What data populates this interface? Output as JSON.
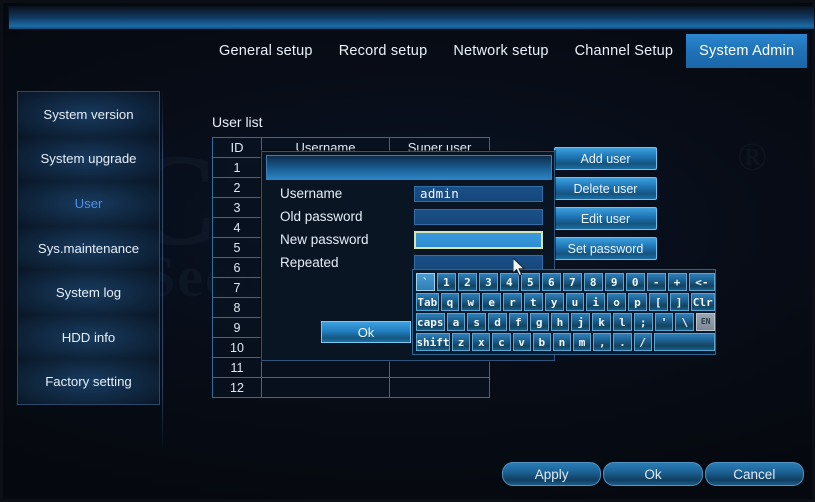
{
  "window": {
    "title": ""
  },
  "nav": {
    "tabs": [
      {
        "label": "General setup",
        "active": false
      },
      {
        "label": "Record setup",
        "active": false
      },
      {
        "label": "Network setup",
        "active": false
      },
      {
        "label": "Channel Setup",
        "active": false
      },
      {
        "label": "System Admin",
        "active": true
      }
    ]
  },
  "sidebar": {
    "items": [
      {
        "label": "System version",
        "active": false
      },
      {
        "label": "System upgrade",
        "active": false
      },
      {
        "label": "User",
        "active": true
      },
      {
        "label": "Sys.maintenance",
        "active": false
      },
      {
        "label": "System log",
        "active": false
      },
      {
        "label": "HDD info",
        "active": false
      },
      {
        "label": "Factory setting",
        "active": false
      }
    ]
  },
  "main": {
    "user_list_label": "User list",
    "table": {
      "headers": [
        "ID",
        "Username",
        "Super user"
      ],
      "rows": [
        {
          "id": "1",
          "username": "",
          "super_user": ""
        },
        {
          "id": "2",
          "username": "",
          "super_user": ""
        },
        {
          "id": "3",
          "username": "",
          "super_user": ""
        },
        {
          "id": "4",
          "username": "",
          "super_user": ""
        },
        {
          "id": "5",
          "username": "",
          "super_user": ""
        },
        {
          "id": "6",
          "username": "",
          "super_user": ""
        },
        {
          "id": "7",
          "username": "",
          "super_user": ""
        },
        {
          "id": "8",
          "username": "",
          "super_user": ""
        },
        {
          "id": "9",
          "username": "",
          "super_user": ""
        },
        {
          "id": "10",
          "username": "",
          "super_user": ""
        },
        {
          "id": "11",
          "username": "",
          "super_user": ""
        },
        {
          "id": "12",
          "username": "",
          "super_user": ""
        }
      ]
    },
    "side_buttons": [
      {
        "label": "Add user"
      },
      {
        "label": "Delete user"
      },
      {
        "label": "Edit user"
      },
      {
        "label": "Set password"
      }
    ]
  },
  "dialog": {
    "title": "",
    "fields": [
      {
        "label": "Username",
        "value": "admin",
        "focused": false
      },
      {
        "label": "Old password",
        "value": "",
        "focused": false
      },
      {
        "label": "New password",
        "value": "",
        "focused": true
      },
      {
        "label": "Repeated",
        "value": "",
        "focused": false
      }
    ],
    "ok_label": "Ok"
  },
  "keyboard": {
    "rows": [
      [
        {
          "label": "`",
          "width": "",
          "selected": true
        },
        {
          "label": "1",
          "width": ""
        },
        {
          "label": "2",
          "width": ""
        },
        {
          "label": "3",
          "width": ""
        },
        {
          "label": "4",
          "width": ""
        },
        {
          "label": "5",
          "width": ""
        },
        {
          "label": "6",
          "width": ""
        },
        {
          "label": "7",
          "width": ""
        },
        {
          "label": "8",
          "width": ""
        },
        {
          "label": "9",
          "width": ""
        },
        {
          "label": "0",
          "width": ""
        },
        {
          "label": "-",
          "width": ""
        },
        {
          "label": "+",
          "width": ""
        },
        {
          "label": "<-",
          "width": "w-bs"
        }
      ],
      [
        {
          "label": "Tab",
          "width": "w-tab"
        },
        {
          "label": "q",
          "width": ""
        },
        {
          "label": "w",
          "width": ""
        },
        {
          "label": "e",
          "width": ""
        },
        {
          "label": "r",
          "width": ""
        },
        {
          "label": "t",
          "width": ""
        },
        {
          "label": "y",
          "width": ""
        },
        {
          "label": "u",
          "width": ""
        },
        {
          "label": "i",
          "width": ""
        },
        {
          "label": "o",
          "width": ""
        },
        {
          "label": "p",
          "width": ""
        },
        {
          "label": "[",
          "width": ""
        },
        {
          "label": "]",
          "width": ""
        },
        {
          "label": "Clr",
          "width": "w-clr"
        }
      ],
      [
        {
          "label": "caps",
          "width": "w-caps"
        },
        {
          "label": "a",
          "width": ""
        },
        {
          "label": "s",
          "width": ""
        },
        {
          "label": "d",
          "width": ""
        },
        {
          "label": "f",
          "width": ""
        },
        {
          "label": "g",
          "width": ""
        },
        {
          "label": "h",
          "width": ""
        },
        {
          "label": "j",
          "width": ""
        },
        {
          "label": "k",
          "width": ""
        },
        {
          "label": "l",
          "width": ""
        },
        {
          "label": ";",
          "width": ""
        },
        {
          "label": "'",
          "width": ""
        },
        {
          "label": "\\",
          "width": ""
        },
        {
          "label": "EN",
          "width": "",
          "ime": true
        }
      ],
      [
        {
          "label": "shift",
          "width": "w-shift"
        },
        {
          "label": "z",
          "width": ""
        },
        {
          "label": "x",
          "width": ""
        },
        {
          "label": "c",
          "width": ""
        },
        {
          "label": "v",
          "width": ""
        },
        {
          "label": "b",
          "width": ""
        },
        {
          "label": "n",
          "width": ""
        },
        {
          "label": "m",
          "width": ""
        },
        {
          "label": ",",
          "width": ""
        },
        {
          "label": ".",
          "width": ""
        },
        {
          "label": "/",
          "width": ""
        },
        {
          "label": "",
          "width": "w-space"
        }
      ]
    ]
  },
  "footer": {
    "buttons": [
      {
        "label": "Apply"
      },
      {
        "label": "Ok"
      },
      {
        "label": "Cancel"
      }
    ]
  },
  "watermark": {
    "text": "CCTV",
    "subtext": "Security",
    "registered": "®"
  },
  "colors": {
    "accent": "#2b87cf",
    "active_sidebar_text": "#4f8fe8",
    "focus_border": "#d8e4b4",
    "panel_bg": "#0a1524",
    "page_bg": "#060a12"
  }
}
